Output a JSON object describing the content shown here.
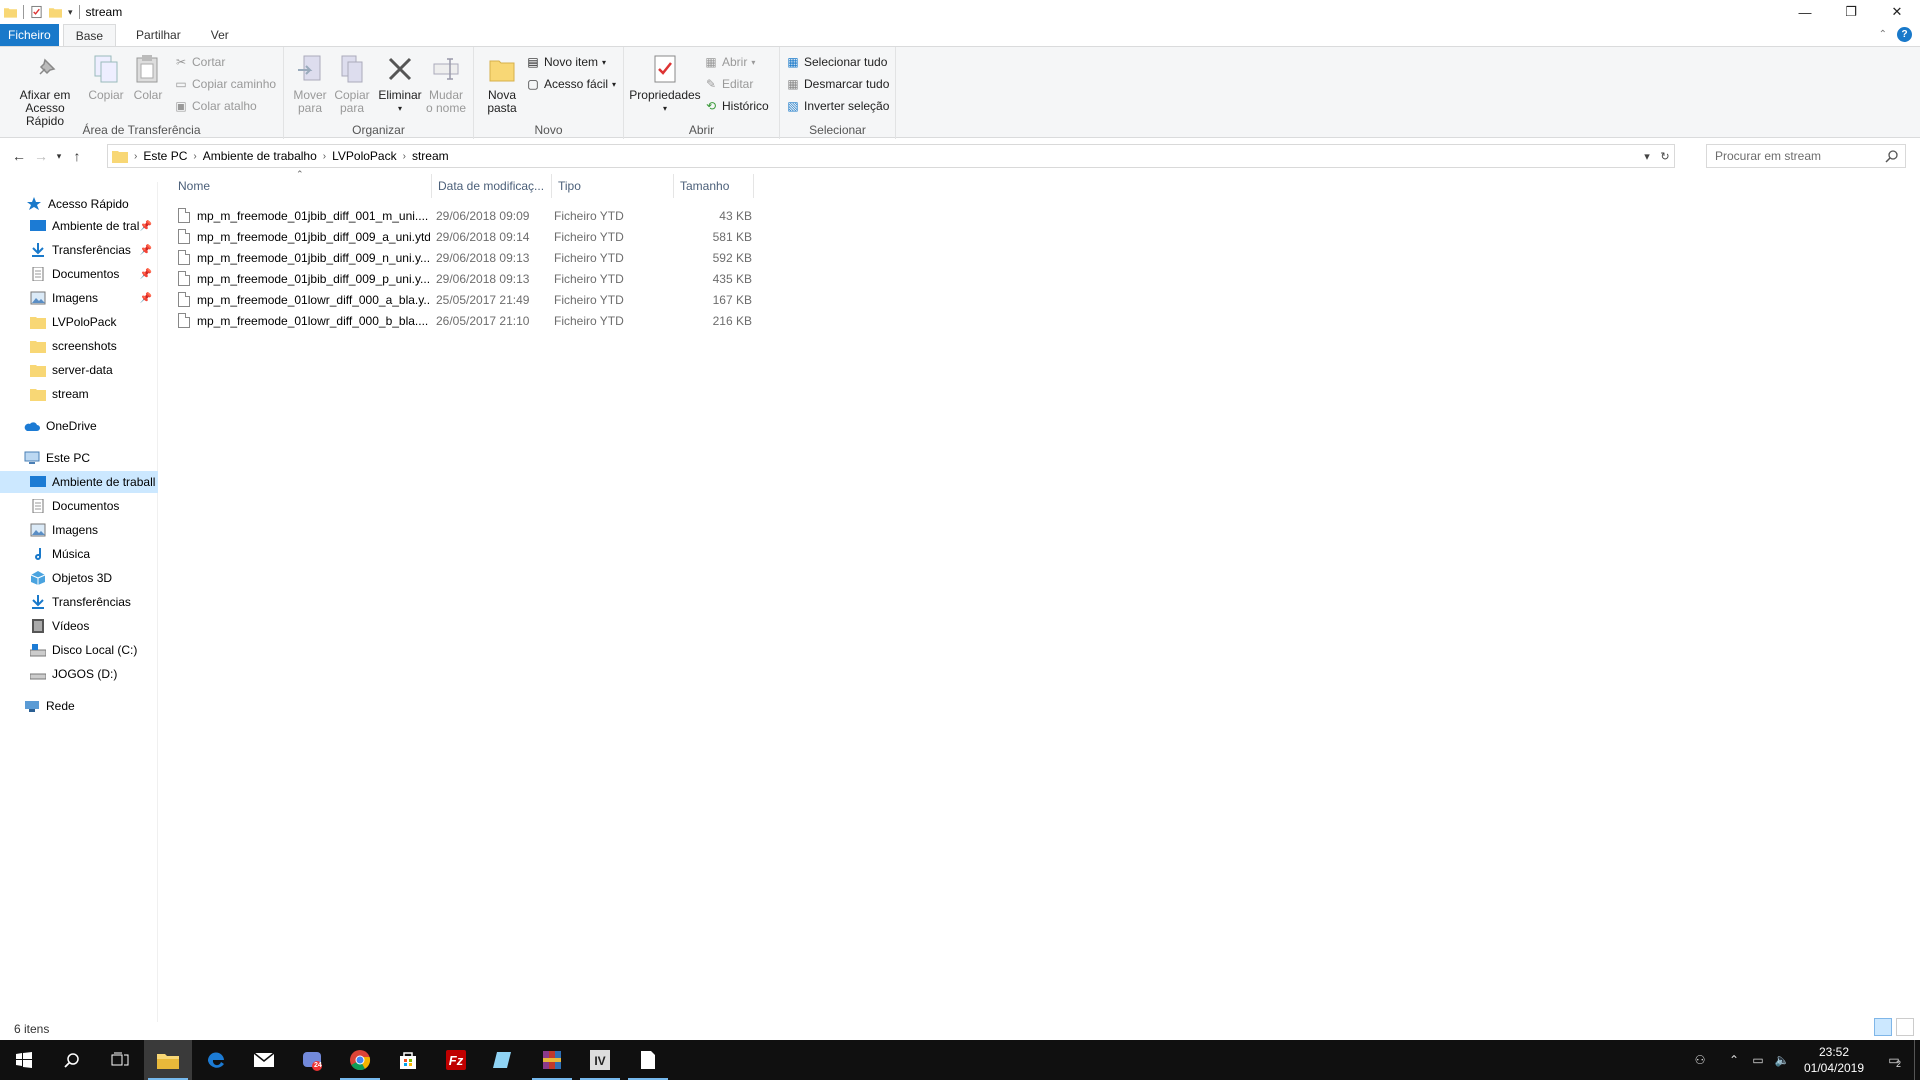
{
  "window": {
    "title": "stream"
  },
  "ribbon_tabs": [
    "Ficheiro",
    "Base",
    "Partilhar",
    "Ver"
  ],
  "ribbon": {
    "clipboard": {
      "label": "Área de Transferência",
      "pin": [
        "Afixar em",
        "Acesso Rápido"
      ],
      "copy": "Copiar",
      "paste": "Colar",
      "cut": "Cortar",
      "copy_path": "Copiar caminho",
      "paste_shortcut": "Colar atalho"
    },
    "organize": {
      "label": "Organizar",
      "move_to": [
        "Mover",
        "para"
      ],
      "copy_to": [
        "Copiar",
        "para"
      ],
      "delete": "Eliminar",
      "rename": [
        "Mudar",
        "o nome"
      ]
    },
    "new": {
      "label": "Novo",
      "new_folder": [
        "Nova",
        "pasta"
      ],
      "new_item": "Novo item",
      "easy_access": "Acesso fácil"
    },
    "open": {
      "label": "Abrir",
      "properties": "Propriedades",
      "open": "Abrir",
      "edit": "Editar",
      "history": "Histórico"
    },
    "select": {
      "label": "Selecionar",
      "select_all": "Selecionar tudo",
      "select_none": "Desmarcar tudo",
      "invert": "Inverter seleção"
    }
  },
  "address": {
    "crumbs": [
      "Este PC",
      "Ambiente de trabalho",
      "LVPoloPack",
      "stream"
    ],
    "search_placeholder": "Procurar em stream"
  },
  "navpane": {
    "quick_access": "Acesso Rápido",
    "quick_items": [
      "Ambiente de tral",
      "Transferências",
      "Documentos",
      "Imagens",
      "LVPoloPack",
      "screenshots",
      "server-data",
      "stream"
    ],
    "onedrive": "OneDrive",
    "this_pc": "Este PC",
    "pc_items": [
      "Ambiente de traball",
      "Documentos",
      "Imagens",
      "Música",
      "Objetos 3D",
      "Transferências",
      "Vídeos",
      "Disco Local (C:)",
      "JOGOS (D:)"
    ],
    "network": "Rede"
  },
  "columns": {
    "name": "Nome",
    "date": "Data de modificaç...",
    "type": "Tipo",
    "size": "Tamanho"
  },
  "files": [
    {
      "name": "mp_m_freemode_01jbib_diff_001_m_uni....",
      "date": "29/06/2018 09:09",
      "type": "Ficheiro YTD",
      "size": "43 KB"
    },
    {
      "name": "mp_m_freemode_01jbib_diff_009_a_uni.ytd",
      "date": "29/06/2018 09:14",
      "type": "Ficheiro YTD",
      "size": "581 KB"
    },
    {
      "name": "mp_m_freemode_01jbib_diff_009_n_uni.y...",
      "date": "29/06/2018 09:13",
      "type": "Ficheiro YTD",
      "size": "592 KB"
    },
    {
      "name": "mp_m_freemode_01jbib_diff_009_p_uni.y...",
      "date": "29/06/2018 09:13",
      "type": "Ficheiro YTD",
      "size": "435 KB"
    },
    {
      "name": "mp_m_freemode_01lowr_diff_000_a_bla.y...",
      "date": "25/05/2017 21:49",
      "type": "Ficheiro YTD",
      "size": "167 KB"
    },
    {
      "name": "mp_m_freemode_01lowr_diff_000_b_bla....",
      "date": "26/05/2017 21:10",
      "type": "Ficheiro YTD",
      "size": "216 KB"
    }
  ],
  "status": {
    "count": "6 itens"
  },
  "taskbar": {
    "clock_time": "23:52",
    "clock_date": "01/04/2019",
    "notification_count": "2",
    "app_badge": "24"
  },
  "colors": {
    "accent": "#1979ca",
    "selection": "#cce8ff",
    "folder": "#f8d775",
    "taskbar": "#101010"
  }
}
